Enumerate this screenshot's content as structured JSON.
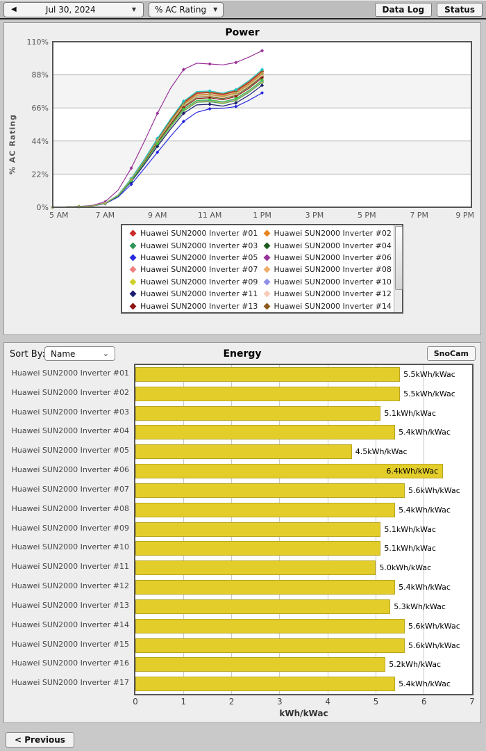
{
  "toolbar": {
    "back_icon": "◀",
    "date_label": "Jul 30, 2024",
    "caret_icon": "▼",
    "metric_label": "% AC Rating",
    "datalog_label": "Data Log",
    "status_label": "Status"
  },
  "power": {
    "title": "Power",
    "ylabel": "% AC Rating"
  },
  "energy": {
    "title": "Energy",
    "sortby_label": "Sort By:",
    "sort_value": "Name",
    "select_caret": "⌄",
    "snocam_label": "SnoCam",
    "xlabel": "kWh/kWac"
  },
  "footer": {
    "previous_label": "< Previous"
  },
  "chart_data": [
    {
      "type": "line",
      "title": "Power",
      "ylabel": "% AC Rating",
      "xlim": [
        5,
        21
      ],
      "ylim": [
        0,
        110
      ],
      "y_ticks": [
        0,
        22,
        44,
        66,
        88,
        110
      ],
      "y_tick_labels": [
        "0%",
        "22%",
        "44%",
        "66%",
        "88%",
        "110%"
      ],
      "x_tick_hours": [
        5,
        7,
        9,
        11,
        13,
        15,
        17,
        19,
        21
      ],
      "x_tick_labels": [
        "5 AM",
        "7 AM",
        "9 AM",
        "11 AM",
        "1 PM",
        "3 PM",
        "5 PM",
        "7 PM",
        "9 PM"
      ],
      "band_color": "#f4f4f4",
      "grid": true,
      "legend_position": "bottom",
      "legend_visible_count": 14,
      "marker": "diamond",
      "x": [
        5,
        5.5,
        6,
        6.5,
        7,
        7.5,
        8,
        8.5,
        9,
        9.5,
        10,
        10.5,
        11,
        11.5,
        12,
        12.5,
        13
      ],
      "series": [
        {
          "name": "Huawei SUN2000 Inverter #01",
          "color": "#cc2929",
          "values": [
            0,
            0.2,
            0.5,
            0.9,
            2.7,
            8.1,
            18.9,
            31.5,
            45,
            57.6,
            69.3,
            75.6,
            76.1,
            74.7,
            77,
            82.8,
            90
          ]
        },
        {
          "name": "Huawei SUN2000 Inverter #02",
          "color": "#e8821e",
          "values": [
            0,
            0.2,
            0.4,
            0.9,
            2.7,
            8,
            18.7,
            31.2,
            44.5,
            57,
            68.5,
            74.8,
            75.2,
            73.9,
            76.1,
            81.9,
            89
          ]
        },
        {
          "name": "Huawei SUN2000 Inverter #03",
          "color": "#2e9658",
          "values": [
            0,
            0.2,
            0.4,
            0.8,
            2.5,
            7.5,
            17.4,
            29.1,
            41.5,
            53.1,
            63.9,
            69.7,
            70.1,
            68.9,
            71,
            76.4,
            83
          ]
        },
        {
          "name": "Huawei SUN2000 Inverter #04",
          "color": "#1c5a1c",
          "values": [
            0,
            0.2,
            0.4,
            0.9,
            2.6,
            7.8,
            18.3,
            30.5,
            43.5,
            55.7,
            67,
            73.1,
            73.5,
            72.2,
            74.4,
            80,
            87
          ]
        },
        {
          "name": "Huawei SUN2000 Inverter #05",
          "color": "#2929e0",
          "values": [
            0,
            0.2,
            0.4,
            0.8,
            2.3,
            6.8,
            15.2,
            25.8,
            36.5,
            47.1,
            57,
            63.1,
            65.4,
            65.7,
            66.9,
            71.1,
            76
          ]
        },
        {
          "name": "Huawei SUN2000 Inverter #06",
          "color": "#993299",
          "values": [
            0,
            0.2,
            0.5,
            1.2,
            3.6,
            11.4,
            26,
            43.7,
            62.4,
            79,
            91.5,
            95.7,
            95.2,
            94.6,
            96.2,
            99.8,
            104
          ]
        },
        {
          "name": "Huawei SUN2000 Inverter #07",
          "color": "#f08080",
          "values": [
            0,
            0.2,
            0.5,
            0.9,
            2.7,
            8.2,
            19.1,
            31.9,
            45.5,
            58.2,
            70.1,
            76.4,
            76.9,
            75.5,
            77.8,
            83.7,
            91
          ]
        },
        {
          "name": "Huawei SUN2000 Inverter #08",
          "color": "#eead68",
          "values": [
            0,
            0.2,
            0.4,
            0.9,
            2.6,
            7.9,
            18.4,
            30.6,
            43.8,
            56,
            67.4,
            73.5,
            73.9,
            72.6,
            74.8,
            80.5,
            87.5
          ]
        },
        {
          "name": "Huawei SUN2000 Inverter #09",
          "color": "#cfcf2a",
          "values": [
            0,
            0.2,
            0.4,
            0.8,
            2.5,
            7.5,
            17.5,
            29.2,
            41.8,
            53.4,
            64.3,
            70.1,
            70.6,
            69.3,
            71.4,
            76.8,
            83.5
          ]
        },
        {
          "name": "Huawei SUN2000 Inverter #10",
          "color": "#8f8fe8",
          "values": [
            0,
            0.2,
            0.4,
            0.8,
            2.5,
            7.6,
            17.6,
            29.4,
            42,
            53.8,
            64.7,
            70.6,
            71,
            69.7,
            71.8,
            77.3,
            84
          ]
        },
        {
          "name": "Huawei SUN2000 Inverter #11",
          "color": "#1c1c70",
          "values": [
            0,
            0.2,
            0.4,
            0.8,
            2.4,
            7.3,
            17,
            28.4,
            40.5,
            51.8,
            62.4,
            68,
            68.4,
            67.2,
            69.3,
            74.5,
            81
          ]
        },
        {
          "name": "Huawei SUN2000 Inverter #12",
          "color": "#f5cdb8",
          "values": [
            0,
            0.2,
            0.4,
            0.9,
            2.6,
            7.9,
            18.5,
            30.8,
            44,
            56.3,
            67.8,
            73.9,
            74.4,
            73,
            75.2,
            81,
            88
          ]
        },
        {
          "name": "Huawei SUN2000 Inverter #13",
          "color": "#8f1414",
          "values": [
            0,
            0.2,
            0.4,
            0.9,
            2.6,
            7.7,
            18.1,
            30.1,
            43,
            55,
            66.2,
            72.2,
            72.7,
            71.4,
            73.5,
            79.1,
            86
          ]
        },
        {
          "name": "Huawei SUN2000 Inverter #14",
          "color": "#8f5a1e",
          "values": [
            0,
            0.2,
            0.5,
            0.9,
            2.7,
            8.1,
            19,
            31.7,
            45.3,
            57.9,
            69.7,
            76,
            76.5,
            75.1,
            77.4,
            83.3,
            90.5
          ]
        },
        {
          "name": "Huawei SUN2000 Inverter #15",
          "color": "#20c8c8",
          "values": [
            0,
            0.2,
            0.5,
            0.9,
            2.7,
            8.2,
            19.2,
            32,
            45.8,
            58.6,
            70.5,
            76.9,
            77.3,
            75.9,
            78.2,
            84.2,
            91.5
          ]
        },
        {
          "name": "Huawei SUN2000 Inverter #16",
          "color": "#3ecc3e",
          "values": [
            0,
            0.2,
            0.4,
            0.8,
            2.5,
            7.6,
            17.7,
            29.6,
            42.3,
            54.1,
            65.1,
            71,
            71.4,
            70.1,
            72.2,
            77.7,
            84.5
          ]
        },
        {
          "name": "Huawei SUN2000 Inverter #17",
          "color": "#a8a860",
          "values": [
            0,
            0.2,
            0.4,
            0.9,
            2.7,
            8,
            18.6,
            31,
            44.3,
            56.6,
            68.1,
            74.3,
            74.8,
            73.5,
            75.7,
            81.4,
            88.5
          ]
        }
      ]
    },
    {
      "type": "bar",
      "title": "Energy",
      "orientation": "horizontal",
      "categories": [
        "Huawei SUN2000 Inverter #01",
        "Huawei SUN2000 Inverter #02",
        "Huawei SUN2000 Inverter #03",
        "Huawei SUN2000 Inverter #04",
        "Huawei SUN2000 Inverter #05",
        "Huawei SUN2000 Inverter #06",
        "Huawei SUN2000 Inverter #07",
        "Huawei SUN2000 Inverter #08",
        "Huawei SUN2000 Inverter #09",
        "Huawei SUN2000 Inverter #10",
        "Huawei SUN2000 Inverter #11",
        "Huawei SUN2000 Inverter #12",
        "Huawei SUN2000 Inverter #13",
        "Huawei SUN2000 Inverter #14",
        "Huawei SUN2000 Inverter #15",
        "Huawei SUN2000 Inverter #16",
        "Huawei SUN2000 Inverter #17"
      ],
      "values": [
        5.5,
        5.5,
        5.1,
        5.4,
        4.5,
        6.4,
        5.6,
        5.4,
        5.1,
        5.1,
        5.0,
        5.4,
        5.3,
        5.6,
        5.6,
        5.2,
        5.4
      ],
      "value_labels": [
        "5.5kWh/kWac",
        "5.5kWh/kWac",
        "5.1kWh/kWac",
        "5.4kWh/kWac",
        "4.5kWh/kWac",
        "6.4kWh/kWac",
        "5.6kWh/kWac",
        "5.4kWh/kWac",
        "5.1kWh/kWac",
        "5.1kWh/kWac",
        "5.0kWh/kWac",
        "5.4kWh/kWac",
        "5.3kWh/kWac",
        "5.6kWh/kWac",
        "5.6kWh/kWac",
        "5.2kWh/kWac",
        "5.4kWh/kWac"
      ],
      "xlabel": "kWh/kWac",
      "xlim": [
        0,
        7
      ],
      "x_ticks": [
        0,
        1,
        2,
        3,
        4,
        5,
        6,
        7
      ],
      "grid": true,
      "bar_color": "#e3cd2b"
    }
  ]
}
